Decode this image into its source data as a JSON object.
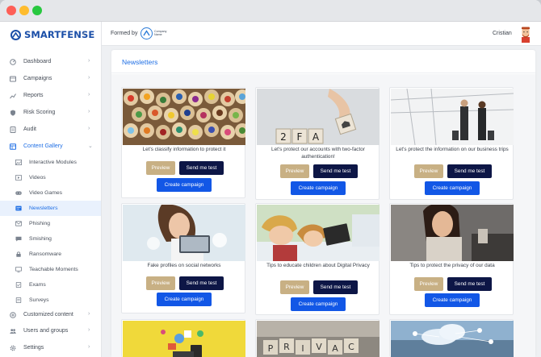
{
  "brand": {
    "name": "SMARTFENSE",
    "accent": "#1f6fe5"
  },
  "header": {
    "formed_by": "Formed by",
    "company_logo_text": "Company Name",
    "user_name": "Cristian"
  },
  "sidebar": {
    "items": [
      {
        "label": "Dashboard",
        "icon": "dashboard-icon"
      },
      {
        "label": "Campaigns",
        "icon": "campaigns-icon"
      },
      {
        "label": "Reports",
        "icon": "reports-icon"
      },
      {
        "label": "Risk Scoring",
        "icon": "shield-icon"
      },
      {
        "label": "Audit",
        "icon": "audit-icon"
      },
      {
        "label": "Content Gallery",
        "icon": "gallery-icon"
      }
    ],
    "sub_items": [
      {
        "label": "Interactive Modules",
        "icon": "image-icon"
      },
      {
        "label": "Videos",
        "icon": "video-icon"
      },
      {
        "label": "Video Games",
        "icon": "gamepad-icon"
      },
      {
        "label": "Newsletters",
        "icon": "newsletter-icon"
      },
      {
        "label": "Phishing",
        "icon": "phishing-icon"
      },
      {
        "label": "Smishing",
        "icon": "sms-icon"
      },
      {
        "label": "Ransomware",
        "icon": "ransomware-icon"
      },
      {
        "label": "Teachable Moments",
        "icon": "teachable-icon"
      },
      {
        "label": "Exams",
        "icon": "exam-icon"
      },
      {
        "label": "Surveys",
        "icon": "survey-icon"
      }
    ],
    "bottom_items": [
      {
        "label": "Customized content",
        "icon": "custom-content-icon"
      },
      {
        "label": "Users and groups",
        "icon": "users-icon"
      },
      {
        "label": "Settings",
        "icon": "gear-icon"
      }
    ]
  },
  "page": {
    "title": "Newsletters"
  },
  "buttons": {
    "preview": "Preview",
    "send_test": "Send me test",
    "create_campaign": "Create campaign"
  },
  "cards": [
    {
      "caption": "Let's classify information to protect it",
      "image": "colored-pencils-photo"
    },
    {
      "caption": "Let's protect our accounts with two-factor authentication!",
      "image": "2fa-blocks-photo"
    },
    {
      "caption": "Let's protect the information on our business trips",
      "image": "airport-travelers-photo"
    },
    {
      "caption": "Fake profiles on social networks",
      "image": "woman-with-phone-photo"
    },
    {
      "caption": "Tips to educate children about Digital Privacy",
      "image": "kids-with-tablet-photo"
    },
    {
      "caption": "Tips to protect the privacy of our data",
      "image": "woman-shushing-photo"
    },
    {
      "caption": "",
      "image": "social-media-icons-photo"
    },
    {
      "caption": "",
      "image": "letter-blocks-photo"
    },
    {
      "caption": "",
      "image": "cloud-network-photo"
    }
  ]
}
